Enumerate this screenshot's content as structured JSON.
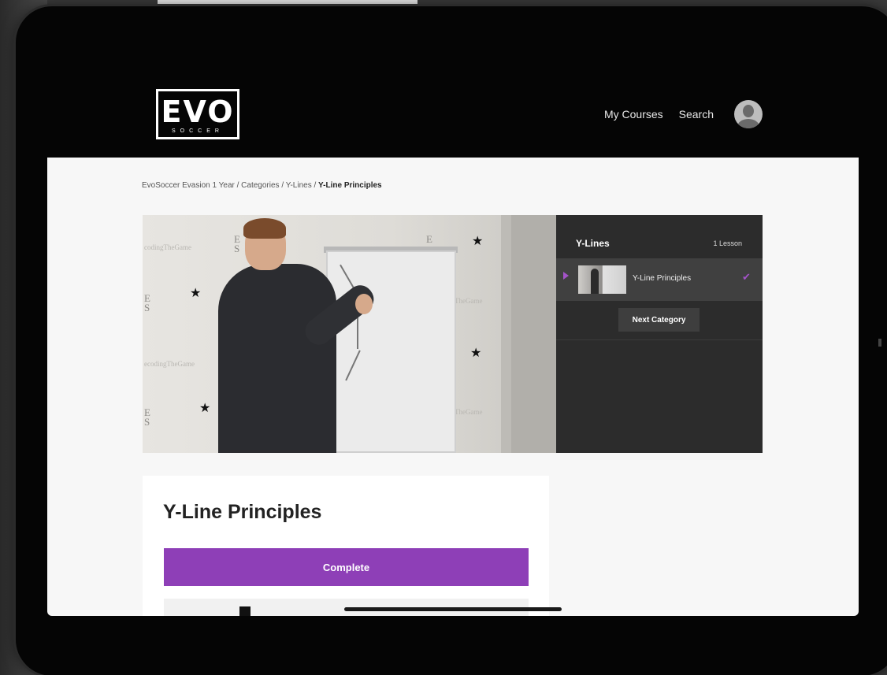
{
  "header": {
    "logo_main": "EVO",
    "logo_sub": "SOCCER",
    "nav": {
      "my_courses": "My Courses",
      "search": "Search"
    }
  },
  "breadcrumb": {
    "items": [
      "EvoSoccer Evasion 1 Year",
      "Categories",
      "Y-Lines"
    ],
    "separator": " / ",
    "current": "Y-Line Principles",
    "path_text": "EvoSoccer Evasion 1 Year / Categories / Y-Lines / "
  },
  "video": {
    "watermark_1": "codingTheGame",
    "watermark_2": "ecodingTheGame",
    "watermark_3": "TheGame"
  },
  "playlist": {
    "title": "Y-Lines",
    "count": "1 Lesson",
    "items": [
      {
        "label": "Y-Line Principles",
        "completed": true
      }
    ],
    "next_category": "Next Category"
  },
  "lesson": {
    "title": "Y-Line Principles",
    "complete_button": "Complete"
  },
  "colors": {
    "accent": "#8e3fb7",
    "header_bg": "#050505",
    "playlist_bg": "#2c2c2c"
  },
  "icons": {
    "avatar": "user-avatar-icon",
    "play": "play-arrow-icon",
    "check": "checkmark-icon"
  }
}
